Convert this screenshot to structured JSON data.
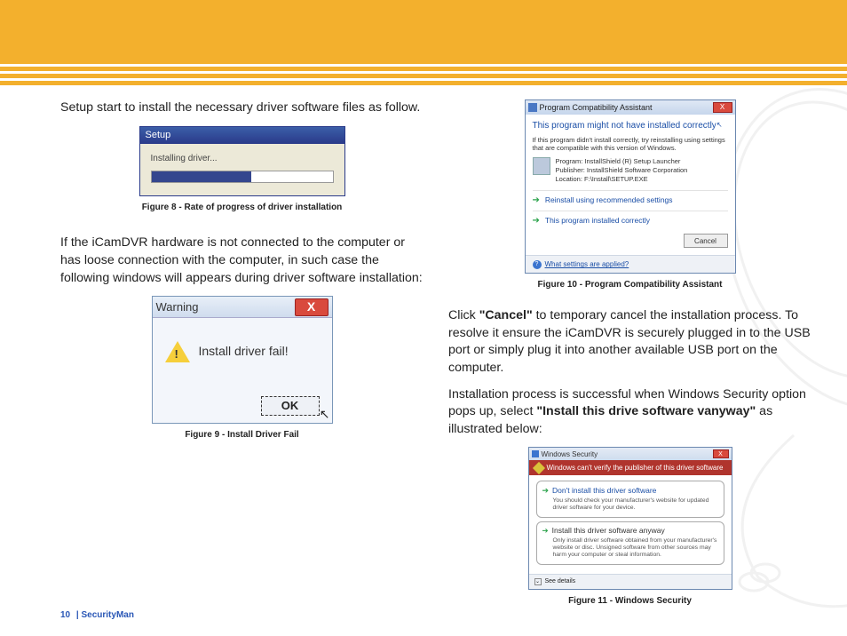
{
  "header": {
    "brand_color": "#f3b02d"
  },
  "left_column": {
    "p1": "Setup start to install the necessary driver software files as follow.",
    "p2": "If the iCamDVR hardware is not connected to the computer or has loose connection with the computer, in such case the following windows will appears during driver software installation:"
  },
  "right_column": {
    "p1_pre": "Click ",
    "p1_bold": "\"Cancel\"",
    "p1_post": " to temporary cancel the installation process.  To resolve it ensure the iCamDVR is securely plugged in to the USB port or simply plug it into another available USB port on the computer.",
    "p2_pre": "Installation process is successful when Windows Security option pops up, select ",
    "p2_bold": "\"Install this drive software vanyway\"",
    "p2_post": " as illustrated below:"
  },
  "fig8": {
    "title": "Setup",
    "label": "Installing driver...",
    "progress_pct": 55,
    "caption": "Figure 8 - Rate of progress of driver installation"
  },
  "fig9": {
    "title": "Warning",
    "msg": "Install driver fail!",
    "ok": "OK",
    "caption": "Figure 9 - Install Driver Fail"
  },
  "fig10": {
    "title": "Program Compatibility Assistant",
    "heading": "This program might not have installed correctly",
    "sub": "If this program didn't install correctly, try reinstalling using settings that are compatible with this version of Windows.",
    "prog_program": "Program: InstallShield (R) Setup Launcher",
    "prog_pub": "Publisher: InstallShield Software Corporation",
    "prog_loc": "Location: F:\\Install\\SETUP.EXE",
    "opt1": "Reinstall using recommended settings",
    "opt2": "This program installed correctly",
    "cancel": "Cancel",
    "foot_link": "What settings are applied?",
    "caption": "Figure 10 -  Program Compatibility Assistant"
  },
  "fig11": {
    "title": "Windows Security",
    "redbar": "Windows can't verify the publisher of this driver software",
    "opt1_head": "Don't install this driver software",
    "opt1_desc": "You should check your manufacturer's website for updated driver software for your device.",
    "opt2_head": "Install this driver software anyway",
    "opt2_desc": "Only install driver software obtained from your manufacturer's website or disc. Unsigned software from other sources may harm your computer or steal information.",
    "foot": "See details",
    "caption": "Figure 11 -  Windows Security"
  },
  "footer": {
    "page": "10",
    "sep": "  |  ",
    "brand": "SecurityMan"
  }
}
